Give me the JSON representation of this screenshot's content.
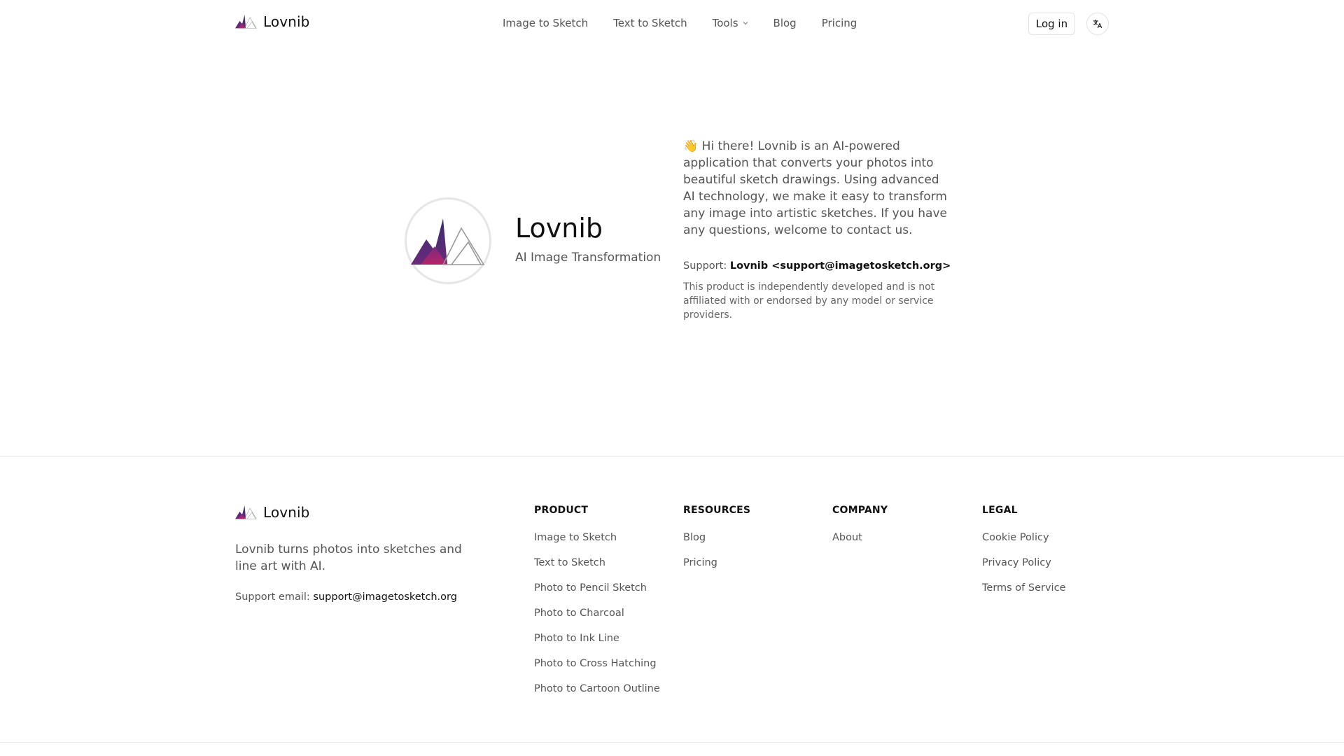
{
  "brand": {
    "name": "Lovnib"
  },
  "nav": {
    "items": [
      {
        "label": "Image to Sketch"
      },
      {
        "label": "Text to Sketch"
      },
      {
        "label": "Tools"
      },
      {
        "label": "Blog"
      },
      {
        "label": "Pricing"
      }
    ],
    "login_label": "Log in"
  },
  "about": {
    "title": "Lovnib",
    "subtitle": "AI Image Transformation",
    "intro": "👋 Hi there! Lovnib is an AI-powered application that converts your photos into beautiful sketch drawings. Using advanced AI technology, we make it easy to transform any image into artistic sketches. If you have any questions, welcome to contact us.",
    "support_label": "Support:",
    "support_value": "Lovnib <support@imagetosketch.org>",
    "disclaimer": "This product is independently developed and is not affiliated with or endorsed by any model or service providers."
  },
  "footer": {
    "brand_name": "Lovnib",
    "tagline": "Lovnib turns photos into sketches and line art with AI.",
    "support_label": "Support email:",
    "support_email": "support@imagetosketch.org",
    "columns": [
      {
        "title": "PRODUCT",
        "links": [
          "Image to Sketch",
          "Text to Sketch",
          "Photo to Pencil Sketch",
          "Photo to Charcoal",
          "Photo to Ink Line",
          "Photo to Cross Hatching",
          "Photo to Cartoon Outline"
        ]
      },
      {
        "title": "RESOURCES",
        "links": [
          "Blog",
          "Pricing"
        ]
      },
      {
        "title": "COMPANY",
        "links": [
          "About"
        ]
      },
      {
        "title": "LEGAL",
        "links": [
          "Cookie Policy",
          "Privacy Policy",
          "Terms of Service"
        ]
      }
    ]
  },
  "icons": {
    "logo": "mountain-logo-icon",
    "tools_caret": "chevron-down-icon",
    "language": "translate-icon"
  },
  "colors": {
    "logo_dark": "#3b2c6e",
    "logo_magenta": "#a8236d",
    "logo_outline": "#9a9a9a",
    "text_primary": "#111111",
    "text_muted": "#555555",
    "divider": "#e8e8e8"
  }
}
